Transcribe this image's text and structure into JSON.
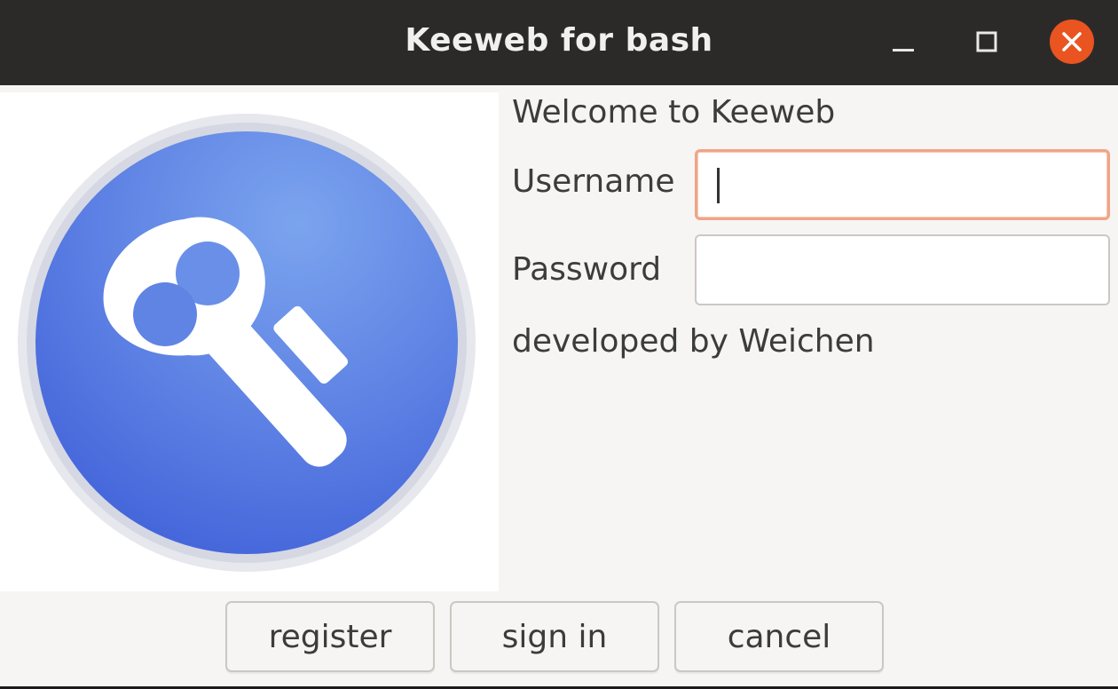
{
  "window": {
    "title": "Keeweb for bash",
    "controls": [
      "minimize-icon",
      "maximize-icon",
      "close-icon"
    ],
    "close_color": "#e95420"
  },
  "logo": {
    "icon": "key-icon",
    "circle_color": "#5a7be6"
  },
  "form": {
    "welcome": "Welcome to Keeweb",
    "username_label": "Username",
    "username_value": "",
    "password_label": "Password",
    "password_value": "",
    "credit": "developed by Weichen"
  },
  "buttons": {
    "register": "register",
    "sign_in": "sign in",
    "cancel": "cancel"
  }
}
